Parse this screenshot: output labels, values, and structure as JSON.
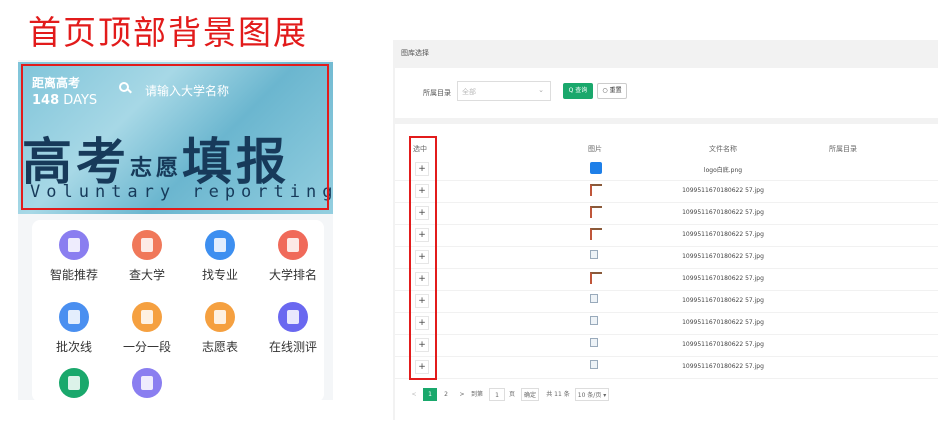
{
  "heading": "首页顶部背景图展",
  "mobile": {
    "deadline_label": "距离高考",
    "deadline_number": "148",
    "deadline_unit": "DAYS",
    "search_placeholder": "请输入大学名称",
    "banner_title": "高考志愿填报",
    "banner_title_main": "高考",
    "banner_title_small": "志愿",
    "banner_title_end": "填报",
    "banner_subtitle": "Voluntary reporting",
    "grid": [
      {
        "label": "智能推荐",
        "icon": "list-icon",
        "color": "#8a7ef0"
      },
      {
        "label": "查大学",
        "icon": "building-icon",
        "color": "#f0785a"
      },
      {
        "label": "找专业",
        "icon": "book-icon",
        "color": "#3d8ff0"
      },
      {
        "label": "大学排名",
        "icon": "ranking-icon",
        "color": "#f06a5a"
      },
      {
        "label": "批次线",
        "icon": "layers-icon",
        "color": "#4a8ff0"
      },
      {
        "label": "一分一段",
        "icon": "stack-icon",
        "color": "#f5a040"
      },
      {
        "label": "志愿表",
        "icon": "form-icon",
        "color": "#f5a040"
      },
      {
        "label": "在线测评",
        "icon": "test-icon",
        "color": "#6a68f0"
      },
      {
        "label": "",
        "icon": "user-icon",
        "color": "#1aa86c"
      },
      {
        "label": "",
        "icon": "document-icon",
        "color": "#8a7ef0"
      }
    ]
  },
  "admin": {
    "breadcrumb": "图库选择",
    "filter_label": "所属目录",
    "filter_value": "全部",
    "query_label": "Q 查询",
    "reset_label": "○ 重置",
    "columns": {
      "select": "选中",
      "image": "图片",
      "filename": "文件名称",
      "directory": "所属目录"
    },
    "rows": [
      {
        "file": "logo白底.png",
        "thumb": "logo"
      },
      {
        "file": "1099511670180622 57.jpg",
        "thumb": "photo"
      },
      {
        "file": "1099511670180622 57.jpg",
        "thumb": "photo"
      },
      {
        "file": "1099511670180622 57.jpg",
        "thumb": "photo"
      },
      {
        "file": "1099511670180622 57.jpg",
        "thumb": "broken"
      },
      {
        "file": "1099511670180622 57.jpg",
        "thumb": "photo"
      },
      {
        "file": "1099511670180622 57.jpg",
        "thumb": "broken"
      },
      {
        "file": "1099511670180622 57.jpg",
        "thumb": "broken"
      },
      {
        "file": "1099511670180622 57.jpg",
        "thumb": "broken"
      },
      {
        "file": "1099511670180622 57.jpg",
        "thumb": "broken"
      }
    ],
    "row_action": "+",
    "pager": {
      "prev": "<",
      "page1": "1",
      "page2": "2",
      "next": ">",
      "goto_label": "到第",
      "goto_value": "1",
      "page_suffix": "页",
      "confirm": "确定",
      "total": "共 11 条",
      "page_size": "10 条/页 ▾"
    }
  }
}
